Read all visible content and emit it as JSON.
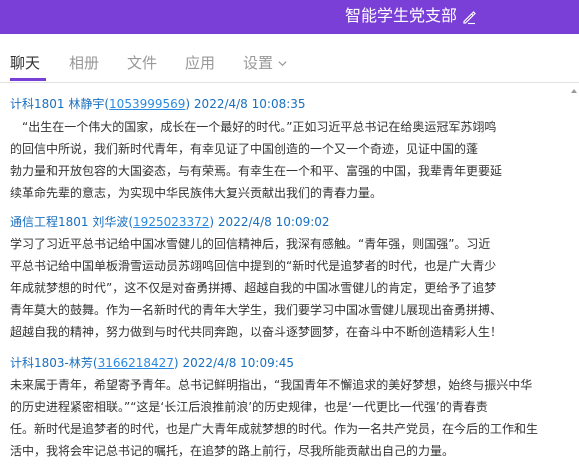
{
  "header": {
    "title": "智能学生党支部"
  },
  "tabs": [
    {
      "label": "聊天",
      "active": true
    },
    {
      "label": "相册",
      "active": false
    },
    {
      "label": "文件",
      "active": false
    },
    {
      "label": "应用",
      "active": false
    },
    {
      "label": "设置",
      "active": false
    }
  ],
  "messages": [
    {
      "sender": "计科1801 林静宇",
      "qq": "1053999569",
      "time": "2022/4/8 10:08:35",
      "lines": [
        "“出生在一个伟大的国家，成长在一个最好的时代。”正如习近平总书记在给奥运冠军苏翊鸣",
        "的回信中所说，我们新时代青年，有幸见证了中国创造的一个又一个奇迹，见证中国的蓬",
        "勃力量和开放包容的大国姿态，与有荣焉。有幸生在一个和平、富强的中国，我辈青年更要延",
        "续革命先辈的意志，为实现中华民族伟大复兴贡献出我们的青春力量。"
      ]
    },
    {
      "sender": "通信工程1801  刘华波",
      "qq": "1925023372",
      "time": "2022/4/8 10:09:02",
      "lines": [
        "学习了习近平总书记给中国冰雪健儿的回信精神后，我深有感触。“青年强，则国强”。习近",
        "平总书记给中国单板滑雪运动员苏翊鸣回信中提到的“新时代是追梦者的时代，也是广大青少",
        "年成就梦想的时代”，这不仅是对奋勇拼搏、超越自我的中国冰雪健儿的肯定，更给予了追梦",
        "青年莫大的鼓舞。作为一名新时代的青年大学生，我们要学习中国冰雪健儿展现出奋勇拼搏、",
        "超越自我的精神，努力做到与时代共同奔跑，以奋斗逐梦圆梦，在奋斗中不断创造精彩人生！"
      ]
    },
    {
      "sender": "计科1803-林芳",
      "qq": "3166218427",
      "time": "2022/4/8 10:09:45",
      "lines": [
        "未来属于青年，希望寄予青年。总书记鲜明指出，“我国青年不懈追求的美好梦想，始终与振兴中华",
        "的历史进程紧密相联。”“这是‘长江后浪推前浪’的历史规律，也是‘一代更比一代强’的青春责",
        "任。新时代是追梦者的时代，也是广大青年成就梦想的时代。作为一名共产党员，在今后的工作和生",
        "活中，我将会牢记总书记的嘱托，在追梦的路上前行，尽我所能贡献出自己的力量。"
      ]
    }
  ]
}
